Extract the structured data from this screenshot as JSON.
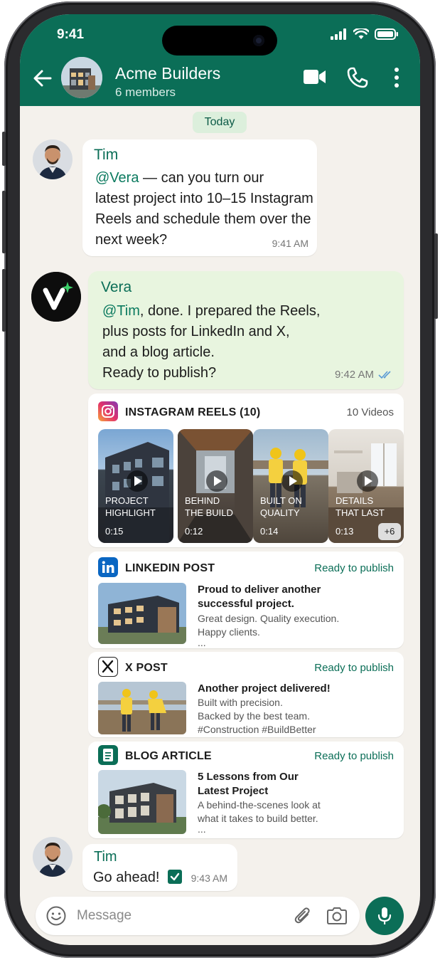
{
  "status_bar": {
    "time": "9:41"
  },
  "header": {
    "title": "Acme Builders",
    "subtitle": "6 members"
  },
  "date_divider": "Today",
  "messages": [
    {
      "sender": "Tim",
      "mention": "@Vera",
      "text_line1": " — can you turn our",
      "text_line2": "latest project into 10–15 Instagram",
      "text_line3": "Reels and schedule them over the",
      "text_line4": "next week?",
      "time": "9:41 AM"
    },
    {
      "sender": "Vera",
      "mention": "@Tim",
      "text_line1": ", done. I prepared the Reels,",
      "text_line2": "plus posts for LinkedIn and X,",
      "text_line3": "and a blog article.",
      "text_line4": "Ready to publish?",
      "time": "9:42 AM",
      "status": "read"
    },
    {
      "sender": "Tim",
      "text": "Go ahead!",
      "time": "9:43 AM"
    }
  ],
  "instagram_card": {
    "title": "INSTAGRAM REELS (10)",
    "count": "10 Videos",
    "reels": [
      {
        "caption_1": "PROJECT",
        "caption_2": "HIGHLIGHT",
        "duration": "0:15"
      },
      {
        "caption_1": "BEHIND",
        "caption_2": "THE BUILD",
        "duration": "0:12"
      },
      {
        "caption_1": "BUILT ON",
        "caption_2": "QUALITY",
        "duration": "0:14"
      },
      {
        "caption_1": "DETAILS",
        "caption_2": "THAT LAST",
        "duration": "0:13"
      }
    ],
    "more": "+6"
  },
  "linkedin_card": {
    "title": "LINKEDIN POST",
    "status": "Ready to publish",
    "headline_1": "Proud to deliver another",
    "headline_2": "successful project.",
    "body_1": "Great design. Quality execution.",
    "body_2": "Happy clients.",
    "body_3": "..."
  },
  "x_card": {
    "title": "X POST",
    "status": "Ready to publish",
    "headline_1": "Another project delivered!",
    "body_1": "Built with precision.",
    "body_2": "Backed by the best team.",
    "body_3": "#Construction #BuildBetter"
  },
  "blog_card": {
    "title": "BLOG ARTICLE",
    "status": "Ready to publish",
    "headline_1": "5 Lessons from Our",
    "headline_2": "Latest Project",
    "body_1": "A behind-the-scenes look at",
    "body_2": "what it takes to build better.",
    "body_3": "..."
  },
  "composer": {
    "placeholder": "Message"
  },
  "colors": {
    "header": "#0b6e57",
    "background": "#f4f1ec",
    "outgoing_bubble": "#e8f5df",
    "accent": "#0b6e57"
  },
  "icons": [
    "back-arrow-icon",
    "video-call-icon",
    "phone-icon",
    "more-icon",
    "emoji-icon",
    "attach-icon",
    "camera-icon",
    "mic-icon",
    "play-icon",
    "read-receipt-icon",
    "checkbox-icon"
  ]
}
